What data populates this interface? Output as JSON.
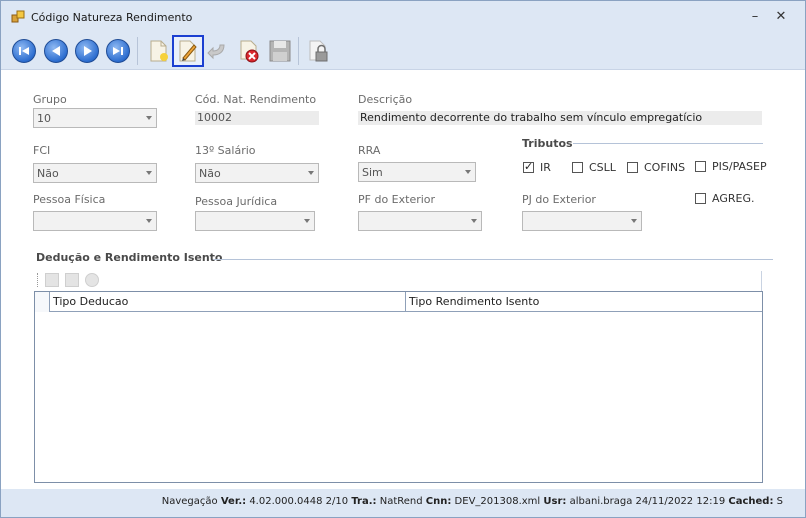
{
  "window": {
    "title": "Código Natureza Rendimento",
    "minimize": "–",
    "close": "✕"
  },
  "toolbar": {
    "buttons": [
      "first-record",
      "previous-record",
      "next-record",
      "last-record",
      "new",
      "edit",
      "undo",
      "delete",
      "save",
      "lock"
    ],
    "selected": "edit"
  },
  "form": {
    "grupo": {
      "label": "Grupo",
      "value": "10"
    },
    "cod_nat": {
      "label": "Cód. Nat. Rendimento",
      "value": "10002"
    },
    "descricao": {
      "label": "Descrição",
      "value": "Rendimento decorrente do trabalho sem vínculo empregatício"
    },
    "fci": {
      "label": "FCI",
      "value": "Não"
    },
    "decimo_terceiro": {
      "label": "13º Salário",
      "value": "Não"
    },
    "rra": {
      "label": "RRA",
      "value": "Sim"
    },
    "pessoa_fisica": {
      "label": "Pessoa Física",
      "value": ""
    },
    "pessoa_juridica": {
      "label": "Pessoa Jurídica",
      "value": ""
    },
    "pf_exterior": {
      "label": "PF do Exterior",
      "value": ""
    },
    "pj_exterior": {
      "label": "PJ do Exterior",
      "value": ""
    }
  },
  "tributos": {
    "title": "Tributos",
    "items": [
      {
        "label": "IR",
        "checked": true
      },
      {
        "label": "CSLL",
        "checked": false
      },
      {
        "label": "COFINS",
        "checked": false
      },
      {
        "label": "PIS/PASEP",
        "checked": false
      },
      {
        "label": "AGREG.",
        "checked": false
      }
    ]
  },
  "deducao": {
    "title": "Dedução e Rendimento Isento",
    "columns": [
      "Tipo Deducao",
      "Tipo Rendimento Isento"
    ]
  },
  "status": {
    "nav_label": "Navegação",
    "ver_label": "Ver.:",
    "ver": "4.02.000.0448",
    "page": "2/10",
    "tra_label": "Tra.:",
    "tra": "NatRend",
    "cnn_label": "Cnn:",
    "cnn": "DEV_201308.xml",
    "usr_label": "Usr:",
    "usr": "albani.braga",
    "date": "24/11/2022",
    "time": "12:19",
    "cached_label": "Cached:",
    "cached": "S"
  }
}
